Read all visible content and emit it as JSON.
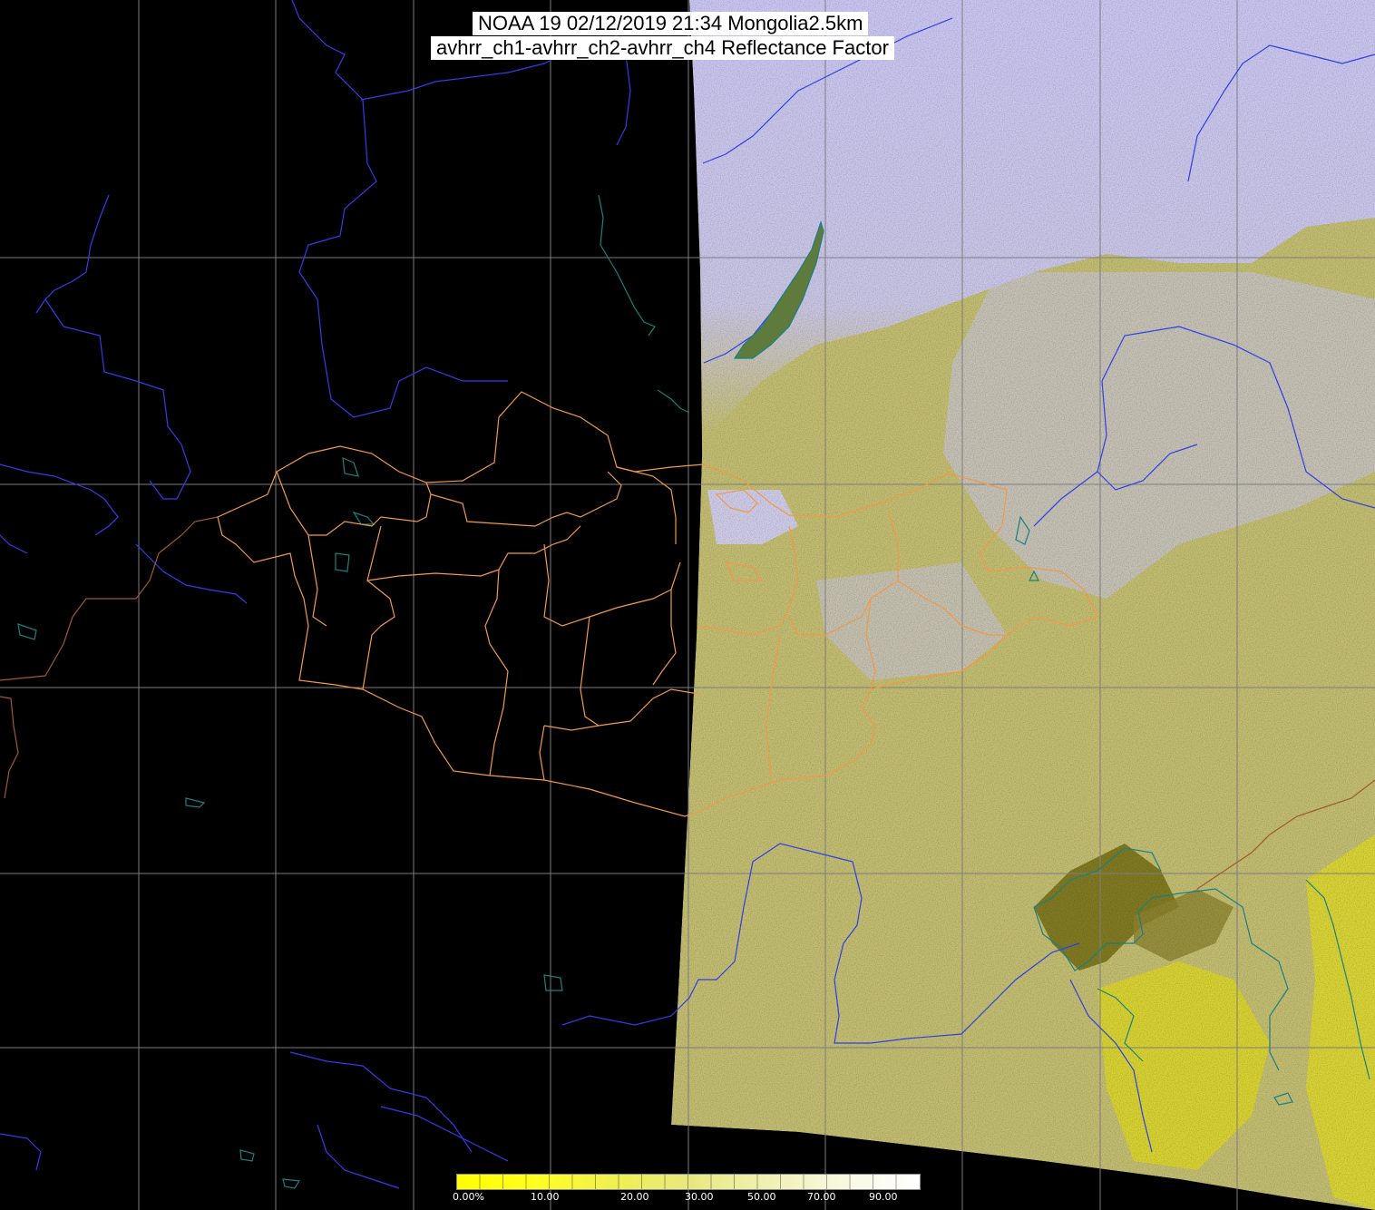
{
  "title": {
    "line1": "NOAA 19 02/12/2019 21:34 Mongolia2.5km",
    "line2": "avhrr_ch1-avhrr_ch2-avhrr_ch4 Reflectance Factor"
  },
  "colors": {
    "background": "#000000",
    "cloud": "#c9c7f2",
    "land": "#c4c070",
    "dark_land": "#807a20",
    "bright_ground": "#e0de30",
    "grid": "#8a8a8a",
    "rivers": "#2e3df0",
    "lakes": "#188080",
    "admin_borders": "#f09a4a",
    "country_border": "#a05a30"
  },
  "legend": {
    "ticks": [
      "0.00%",
      "10.00",
      "20.00",
      "30.00",
      "50.00",
      "70.00",
      "90.00"
    ],
    "gradient": [
      "#ffff00",
      "#ffff20",
      "#f0f050",
      "#e8e880",
      "#f0f0b0",
      "#f8f8e0",
      "#ffffff"
    ]
  }
}
